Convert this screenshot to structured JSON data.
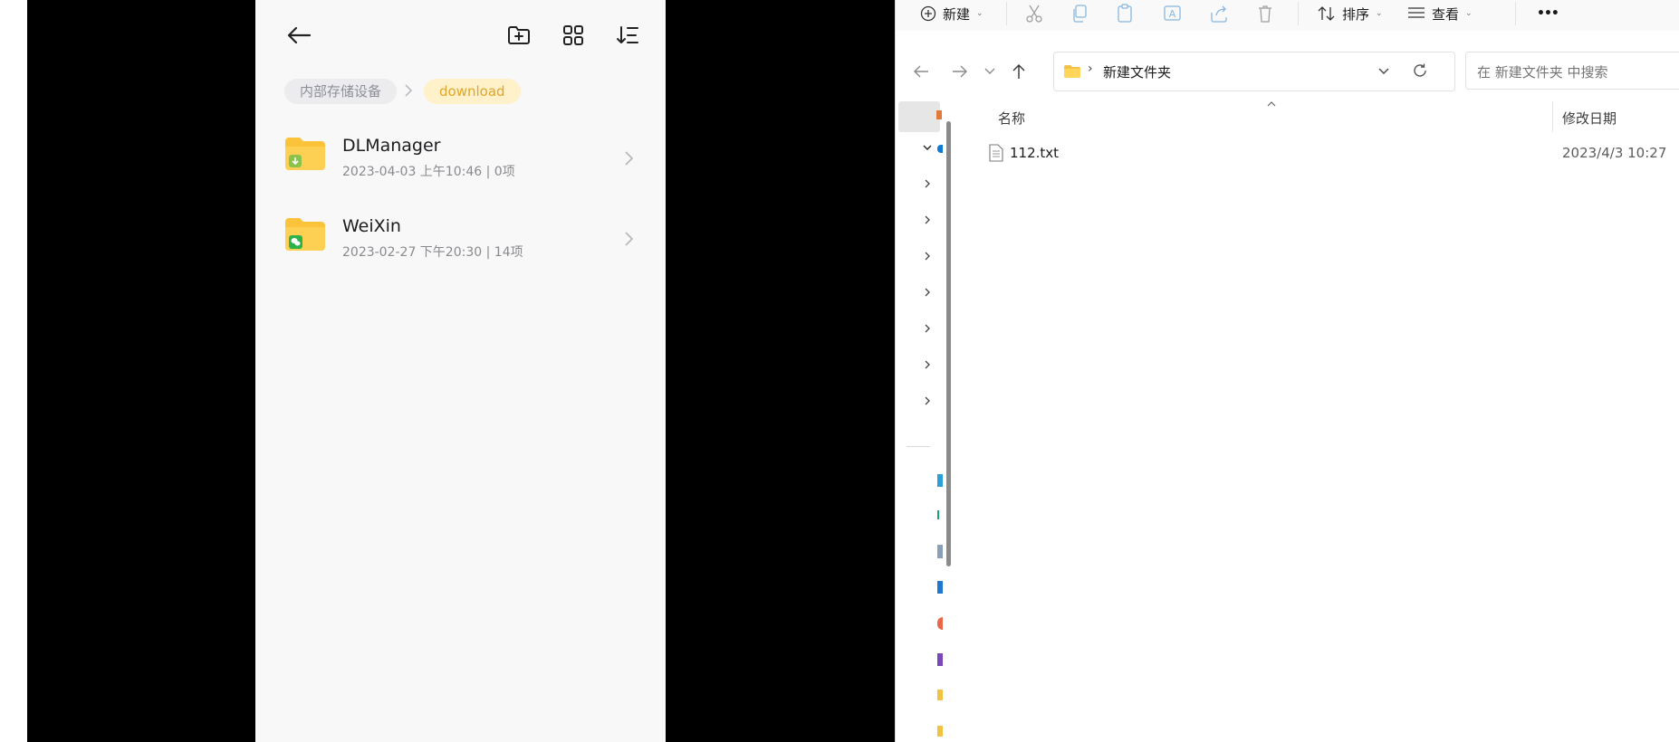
{
  "phone": {
    "breadcrumb": [
      "内部存储设备",
      "download"
    ],
    "folders": [
      {
        "name": "DLManager",
        "date": "2023-04-03 上午10:46",
        "count": "0项",
        "badge": "download"
      },
      {
        "name": "WeiXin",
        "date": "2023-02-27 下午20:30",
        "count": "14项",
        "badge": "wechat"
      }
    ],
    "toolbar_icons": [
      "back-arrow-icon",
      "new-folder-icon",
      "grid-view-icon",
      "sort-icon"
    ]
  },
  "explorer": {
    "toolbar": {
      "new_label": "新建",
      "sort_label": "排序",
      "view_label": "查看",
      "more_label": "•••"
    },
    "address": {
      "path": "新建文件夹"
    },
    "search": {
      "placeholder": "在 新建文件夹 中搜索"
    },
    "columns": {
      "name": "名称",
      "modified": "修改日期"
    },
    "files": [
      {
        "name": "112.txt",
        "modified": "2023/4/3 10:27"
      }
    ]
  },
  "colors": {
    "folder_yellow": "#fbc33a",
    "wechat_green": "#2bb34a",
    "download_green": "#8bc34a",
    "crumb_active": "#e0a52a"
  }
}
